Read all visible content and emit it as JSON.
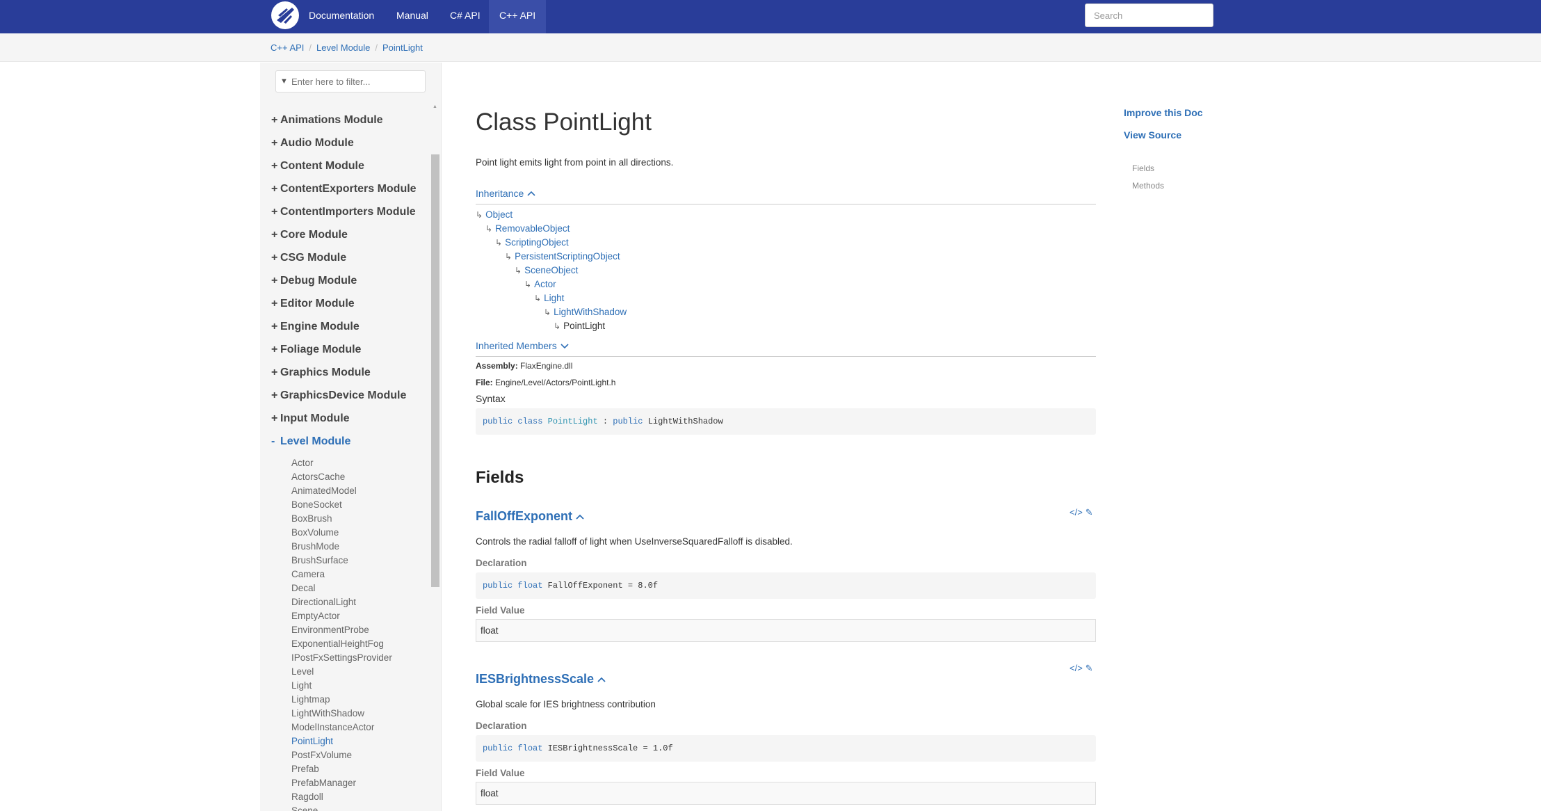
{
  "navbar": {
    "logo_icon": "flax-logo-icon",
    "links": [
      {
        "label": "Documentation"
      },
      {
        "label": "Manual"
      },
      {
        "label": "C# API"
      },
      {
        "label": "C++ API"
      }
    ],
    "active_link": "C++ API",
    "search_placeholder": "Search"
  },
  "breadcrumb": [
    "C++ API",
    "Level Module",
    "PointLight"
  ],
  "sidebar": {
    "filter_placeholder": "Enter here to filter...",
    "filter_icon": "funnel-icon",
    "modules": [
      {
        "sign": "+",
        "label": "Animations Module"
      },
      {
        "sign": "+",
        "label": "Audio Module"
      },
      {
        "sign": "+",
        "label": "Content Module"
      },
      {
        "sign": "+",
        "label": "ContentExporters Module"
      },
      {
        "sign": "+",
        "label": "ContentImporters Module"
      },
      {
        "sign": "+",
        "label": "Core Module"
      },
      {
        "sign": "+",
        "label": "CSG Module"
      },
      {
        "sign": "+",
        "label": "Debug Module"
      },
      {
        "sign": "+",
        "label": "Editor Module"
      },
      {
        "sign": "+",
        "label": "Engine Module"
      },
      {
        "sign": "+",
        "label": "Foliage Module"
      },
      {
        "sign": "+",
        "label": "Graphics Module"
      },
      {
        "sign": "+",
        "label": "GraphicsDevice Module"
      },
      {
        "sign": "+",
        "label": "Input Module"
      },
      {
        "sign": "-",
        "label": "Level Module"
      }
    ],
    "level_items": [
      "Actor",
      "ActorsCache",
      "AnimatedModel",
      "BoneSocket",
      "BoxBrush",
      "BoxVolume",
      "BrushMode",
      "BrushSurface",
      "Camera",
      "Decal",
      "DirectionalLight",
      "EmptyActor",
      "EnvironmentProbe",
      "ExponentialHeightFog",
      "IPostFxSettingsProvider",
      "Level",
      "Light",
      "Lightmap",
      "LightWithShadow",
      "ModelInstanceActor",
      "PointLight",
      "PostFxVolume",
      "Prefab",
      "PrefabManager",
      "Ragdoll",
      "Scene"
    ],
    "active_item": "PointLight"
  },
  "article": {
    "title": "Class PointLight",
    "summary": "Point light emits light from point in all directions.",
    "inheritance_label": "Inheritance",
    "inheritance": [
      "Object",
      "RemovableObject",
      "ScriptingObject",
      "PersistentScriptingObject",
      "SceneObject",
      "Actor",
      "Light",
      "LightWithShadow",
      "PointLight"
    ],
    "inherited_members_label": "Inherited Members",
    "assembly_label": "Assembly:",
    "assembly": "FlaxEngine.dll",
    "file_label": "File:",
    "file": "Engine/Level/Actors/PointLight.h",
    "syntax_label": "Syntax",
    "syntax": {
      "kw1": "public",
      "kw2": "class",
      "name": "PointLight",
      "colon": ":",
      "kw3": "public",
      "base": "LightWithShadow"
    },
    "fields_heading": "Fields",
    "fields": [
      {
        "name": "FallOffExponent",
        "description": "Controls the radial falloff of light when UseInverseSquaredFalloff is disabled.",
        "declaration_label": "Declaration",
        "decl_kw": "public",
        "decl_type": "float",
        "decl_rest": "FallOffExponent = 8.0f",
        "field_value_label": "Field Value",
        "field_value": "float",
        "view_source_icon": "code-icon",
        "edit_icon": "pencil-icon"
      },
      {
        "name": "IESBrightnessScale",
        "description": "Global scale for IES brightness contribution",
        "declaration_label": "Declaration",
        "decl_kw": "public",
        "decl_type": "float",
        "decl_rest": "IESBrightnessScale = 1.0f",
        "field_value_label": "Field Value",
        "field_value": "float",
        "view_source_icon": "code-icon",
        "edit_icon": "pencil-icon"
      }
    ]
  },
  "affix": {
    "improve": "Improve this Doc",
    "view_source": "View Source",
    "sections": [
      "Fields",
      "Methods"
    ]
  },
  "colors": {
    "navbar": "#293d99",
    "link": "#2e6fb6",
    "sidebar_bg": "#f5f5f5"
  }
}
